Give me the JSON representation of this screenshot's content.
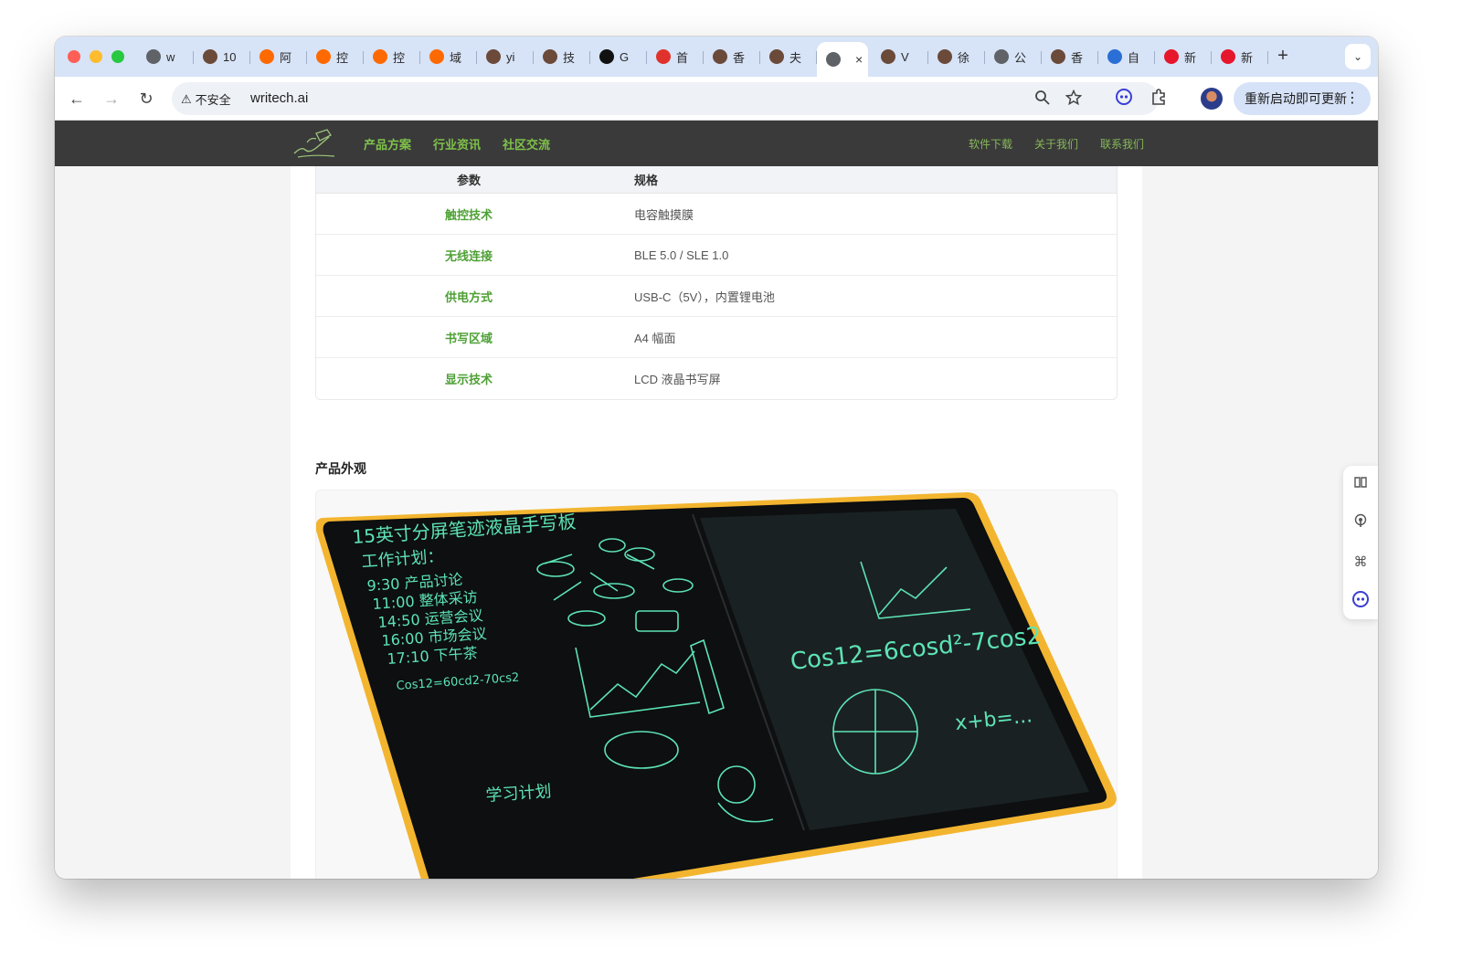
{
  "browser": {
    "tabs": [
      {
        "label": "w",
        "icon": "globe-icon",
        "color": "#5f6368"
      },
      {
        "label": "10",
        "icon": "avatar-icon",
        "color": "#6b4a3a"
      },
      {
        "label": "阿",
        "icon": "bracket-icon",
        "color": "#ff6a00"
      },
      {
        "label": "控",
        "icon": "bracket-icon",
        "color": "#ff6a00"
      },
      {
        "label": "控",
        "icon": "bracket-icon",
        "color": "#ff6a00"
      },
      {
        "label": "域",
        "icon": "bracket-icon",
        "color": "#ff6a00"
      },
      {
        "label": "yi",
        "icon": "avatar-icon",
        "color": "#6b4a3a"
      },
      {
        "label": "技",
        "icon": "avatar-icon",
        "color": "#6b4a3a"
      },
      {
        "label": "G",
        "icon": "triangle-icon",
        "color": "#111111"
      },
      {
        "label": "首",
        "icon": "brand-icon",
        "color": "#e0322c"
      },
      {
        "label": "香",
        "icon": "avatar-icon",
        "color": "#6b4a3a"
      },
      {
        "label": "夫",
        "icon": "avatar-icon",
        "color": "#6b4a3a"
      },
      {
        "label": "",
        "icon": "globe-icon",
        "color": "#5f6368",
        "active": true
      },
      {
        "label": "V",
        "icon": "avatar-icon",
        "color": "#6b4a3a"
      },
      {
        "label": "徐",
        "icon": "avatar-icon",
        "color": "#6b4a3a"
      },
      {
        "label": "公",
        "icon": "globe-icon",
        "color": "#5f6368"
      },
      {
        "label": "香",
        "icon": "avatar-icon",
        "color": "#6b4a3a"
      },
      {
        "label": "自",
        "icon": "brand-icon",
        "color": "#2a6fd6"
      },
      {
        "label": "新",
        "icon": "weibo-icon",
        "color": "#e6162d"
      },
      {
        "label": "新",
        "icon": "weibo-icon",
        "color": "#e6162d"
      }
    ],
    "new_tab": "+",
    "tab_menu": "⌄",
    "back": "←",
    "forward": "→",
    "reload": "↻",
    "security_label": "不安全",
    "security_icon": "⚠",
    "url": "writech.ai",
    "update_button": "重新启动即可更新",
    "update_menu": "⋮"
  },
  "site": {
    "nav_left": [
      "产品方案",
      "行业资讯",
      "社区交流"
    ],
    "nav_right": [
      "软件下载",
      "关于我们",
      "联系我们"
    ],
    "spec_header": {
      "param": "参数",
      "spec": "规格"
    },
    "spec_rows": [
      {
        "param": "触控技术",
        "spec": "电容触摸膜"
      },
      {
        "param": "无线连接",
        "spec": "BLE 5.0 / SLE 1.0"
      },
      {
        "param": "供电方式",
        "spec": "USB-C（5V），内置锂电池"
      },
      {
        "param": "书写区域",
        "spec": "A4 幅面"
      },
      {
        "param": "显示技术",
        "spec": "LCD 液晶书写屏"
      }
    ],
    "section_title": "产品外观",
    "product_image": {
      "left_screen_lines": [
        "15英寸分屏笔迹液晶手写板",
        "工作计划：",
        "9:30  产品讨论",
        "11:00 整体采访",
        "14:50 运营会议",
        "16:00 市场会议",
        "17:10 下午茶",
        "Cos12=60cd2-70cs2",
        "学习计划"
      ],
      "right_formula": "Cos12=6cosd²-7cos2",
      "right_formula2": "x+b=...",
      "accent_color": "#5de3b4",
      "frame_color": "#f3b52f"
    },
    "accent": "#7fc24a"
  }
}
